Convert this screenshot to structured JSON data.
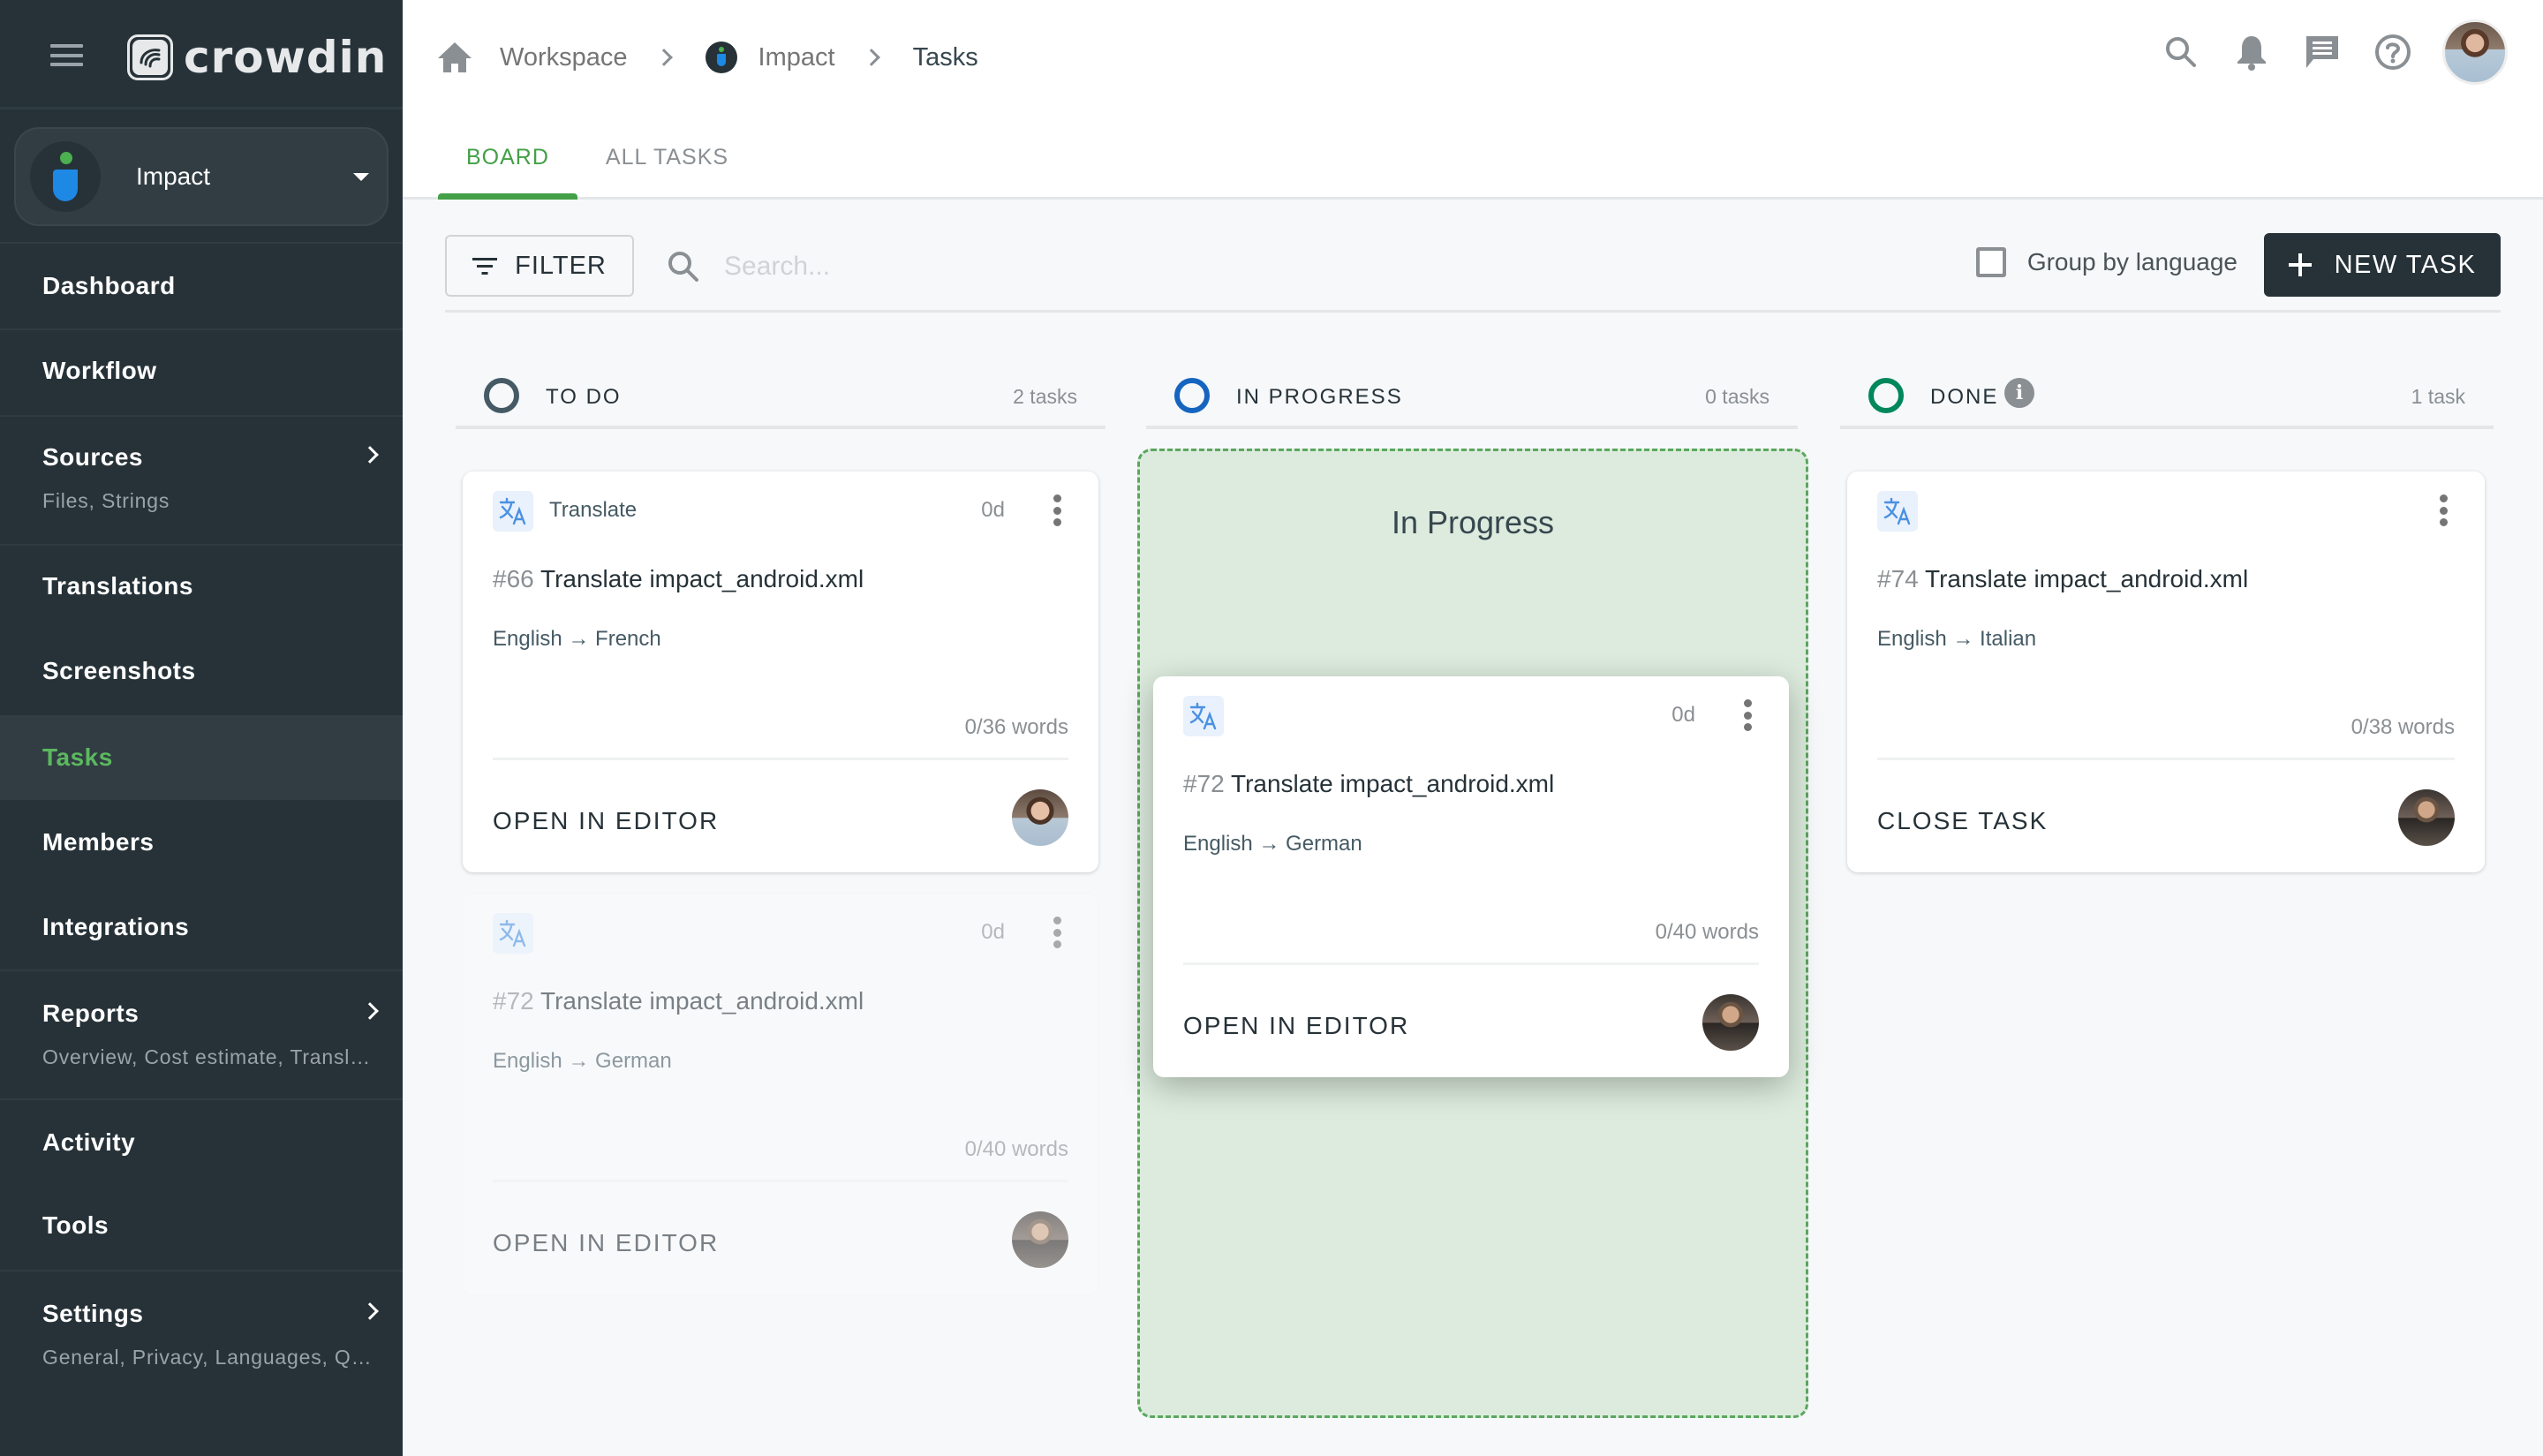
{
  "app": {
    "brand": "crowdin"
  },
  "sidebar": {
    "project_selector": {
      "name": "Impact"
    },
    "items": [
      {
        "label": "Dashboard",
        "sub": null,
        "has_children": false
      },
      {
        "label": "Workflow",
        "sub": null,
        "has_children": false
      },
      {
        "label": "Sources",
        "sub": "Files, Strings",
        "has_children": true
      },
      {
        "label": "Translations",
        "sub": null,
        "has_children": false
      },
      {
        "label": "Screenshots",
        "sub": null,
        "has_children": false
      },
      {
        "label": "Tasks",
        "sub": null,
        "has_children": false,
        "active": true
      },
      {
        "label": "Members",
        "sub": null,
        "has_children": false
      },
      {
        "label": "Integrations",
        "sub": null,
        "has_children": false
      },
      {
        "label": "Reports",
        "sub": "Overview, Cost estimate, Transl…",
        "has_children": true
      },
      {
        "label": "Activity",
        "sub": null,
        "has_children": false
      },
      {
        "label": "Tools",
        "sub": null,
        "has_children": false
      },
      {
        "label": "Settings",
        "sub": "General, Privacy, Languages, Q…",
        "has_children": true
      }
    ]
  },
  "header": {
    "breadcrumb": [
      "Workspace",
      "Impact",
      "Tasks"
    ],
    "icons": [
      "search-icon",
      "bell-icon",
      "chat-icon",
      "help-icon",
      "user-avatar"
    ],
    "tabs": [
      {
        "label": "BOARD",
        "active": true
      },
      {
        "label": "ALL TASKS",
        "active": false
      }
    ]
  },
  "toolbar": {
    "filter_label": "FILTER",
    "search_placeholder": "Search...",
    "search_value": "",
    "group_by_language_label": "Group by language",
    "group_by_language_checked": false,
    "new_task_label": "NEW TASK"
  },
  "colors": {
    "accent_green": "#43a047",
    "sidebar_bg": "#263238",
    "todo_ring": "#455a64",
    "in_progress_ring": "#1565c0",
    "done_ring": "#00875a",
    "dropzone_bg": "#dcebdd",
    "dropzone_border": "#5ba65e"
  },
  "columns": [
    {
      "title": "TO DO",
      "count": "2 tasks"
    },
    {
      "title": "IN PROGRESS",
      "count": "0 tasks",
      "dropzone_label": "In Progress"
    },
    {
      "title": "DONE",
      "count": "1 task"
    }
  ],
  "cards": {
    "todo_1": {
      "type": "Translate",
      "age": "0d",
      "num": "#66",
      "title": "Translate impact_android.xml",
      "langs": "English → French",
      "words": "0/36 words",
      "action": "OPEN IN EDITOR"
    },
    "todo_ghost": {
      "type": "",
      "age": "0d",
      "num": "#72",
      "title": "Translate impact_android.xml",
      "langs": "English → German",
      "words": "0/40 words",
      "action": "OPEN IN EDITOR"
    },
    "dragging": {
      "type": "",
      "age": "0d",
      "num": "#72",
      "title": "Translate impact_android.xml",
      "langs": "English → German",
      "words": "0/40 words",
      "action": "OPEN IN EDITOR"
    },
    "done_1": {
      "type": "",
      "age": "",
      "num": "#74",
      "title": "Translate impact_android.xml",
      "langs": "English → Italian",
      "words": "0/38 words",
      "action": "CLOSE TASK"
    }
  }
}
